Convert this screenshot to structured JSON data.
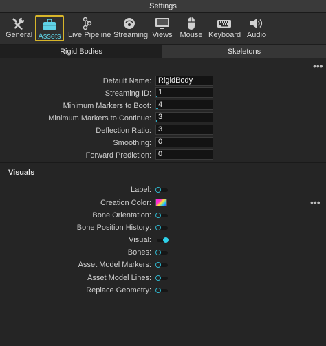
{
  "window": {
    "title": "Settings"
  },
  "toolbar": {
    "items": [
      {
        "label": "General",
        "icon": "tools-icon"
      },
      {
        "label": "Assets",
        "icon": "briefcase-icon",
        "active": true
      },
      {
        "label": "Live Pipeline",
        "icon": "pipeline-icon"
      },
      {
        "label": "Streaming",
        "icon": "streaming-icon"
      },
      {
        "label": "Views",
        "icon": "monitor-icon"
      },
      {
        "label": "Mouse",
        "icon": "mouse-icon"
      },
      {
        "label": "Keyboard",
        "icon": "keyboard-icon"
      },
      {
        "label": "Audio",
        "icon": "speaker-icon"
      }
    ]
  },
  "tabs": [
    {
      "label": "Rigid Bodies",
      "active": true
    },
    {
      "label": "Skeletons",
      "active": false
    }
  ],
  "rigid_bodies": {
    "fields": [
      {
        "label": "Default Name:",
        "value": "RigidBody"
      },
      {
        "label": "Streaming ID:",
        "value": "1"
      },
      {
        "label": "Minimum Markers to Boot:",
        "value": "4"
      },
      {
        "label": "Minimum Markers to Continue:",
        "value": "3"
      },
      {
        "label": "Deflection Ratio:",
        "value": "3"
      },
      {
        "label": "Smoothing:",
        "value": "0"
      },
      {
        "label": "Forward Prediction:",
        "value": "0"
      }
    ]
  },
  "visuals": {
    "title": "Visuals",
    "rows": [
      {
        "label": "Label:",
        "type": "toggle",
        "on": false
      },
      {
        "label": "Creation Color:",
        "type": "color"
      },
      {
        "label": "Bone Orientation:",
        "type": "toggle",
        "on": false
      },
      {
        "label": "Bone Position History:",
        "type": "toggle",
        "on": false
      },
      {
        "label": "Visual:",
        "type": "toggle",
        "on": true
      },
      {
        "label": "Bones:",
        "type": "toggle",
        "on": false
      },
      {
        "label": "Asset Model Markers:",
        "type": "toggle",
        "on": false
      },
      {
        "label": "Asset Model Lines:",
        "type": "toggle",
        "on": false
      },
      {
        "label": "Replace Geometry:",
        "type": "toggle",
        "on": false
      }
    ]
  },
  "colors": {
    "accent": "#2fd2ea",
    "active_border": "#d7b52a"
  }
}
